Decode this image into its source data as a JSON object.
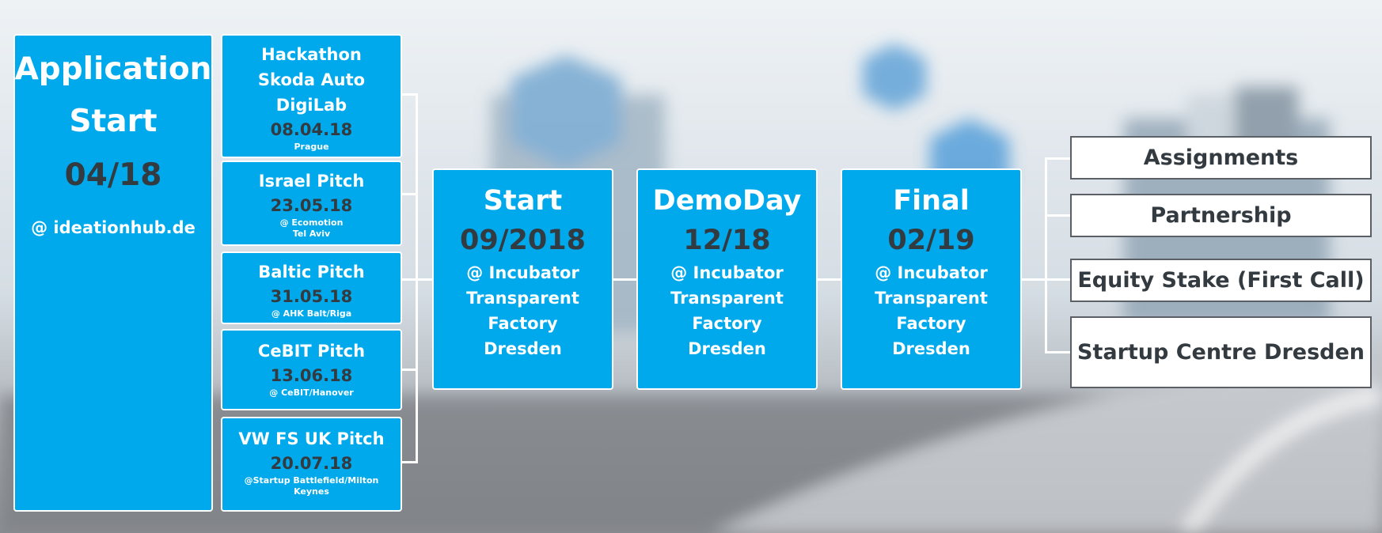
{
  "application": {
    "line1": "Application",
    "line2": "Start",
    "date": "04/18",
    "location": "@ ideationhub.de"
  },
  "pitches": [
    {
      "title_lines": [
        "Hackathon",
        "Skoda Auto",
        "DigiLab"
      ],
      "date": "08.04.18",
      "place_lines": [
        "Prague"
      ]
    },
    {
      "title_lines": [
        "Israel Pitch"
      ],
      "date": "23.05.18",
      "place_lines": [
        "@ Ecomotion",
        "Tel Aviv"
      ]
    },
    {
      "title_lines": [
        "Baltic Pitch"
      ],
      "date": "31.05.18",
      "place_lines": [
        "@ AHK Balt/Riga"
      ]
    },
    {
      "title_lines": [
        "CeBIT Pitch"
      ],
      "date": "13.06.18",
      "place_lines": [
        "@ CeBIT/Hanover"
      ]
    },
    {
      "title_lines": [
        "VW FS UK Pitch"
      ],
      "date": "20.07.18",
      "place_lines": [
        "@Startup Battlefield/Milton",
        "Keynes"
      ]
    }
  ],
  "stages": [
    {
      "title": "Start",
      "date": "09/2018",
      "place_lines": [
        "@ Incubator",
        "Transparent",
        "Factory",
        "Dresden"
      ]
    },
    {
      "title": "DemoDay",
      "date": "12/18",
      "place_lines": [
        "@ Incubator",
        "Transparent",
        "Factory",
        "Dresden"
      ]
    },
    {
      "title": "Final",
      "date": "02/19",
      "place_lines": [
        "@ Incubator",
        "Transparent",
        "Factory",
        "Dresden"
      ]
    }
  ],
  "outcomes": [
    "Assignments",
    "Partnership",
    "Equity Stake (First Call)",
    "Startup Centre Dresden"
  ],
  "colors": {
    "box_blue": "#00a9eb",
    "dark_text": "#333a40",
    "outcome_border": "#5a6066"
  }
}
